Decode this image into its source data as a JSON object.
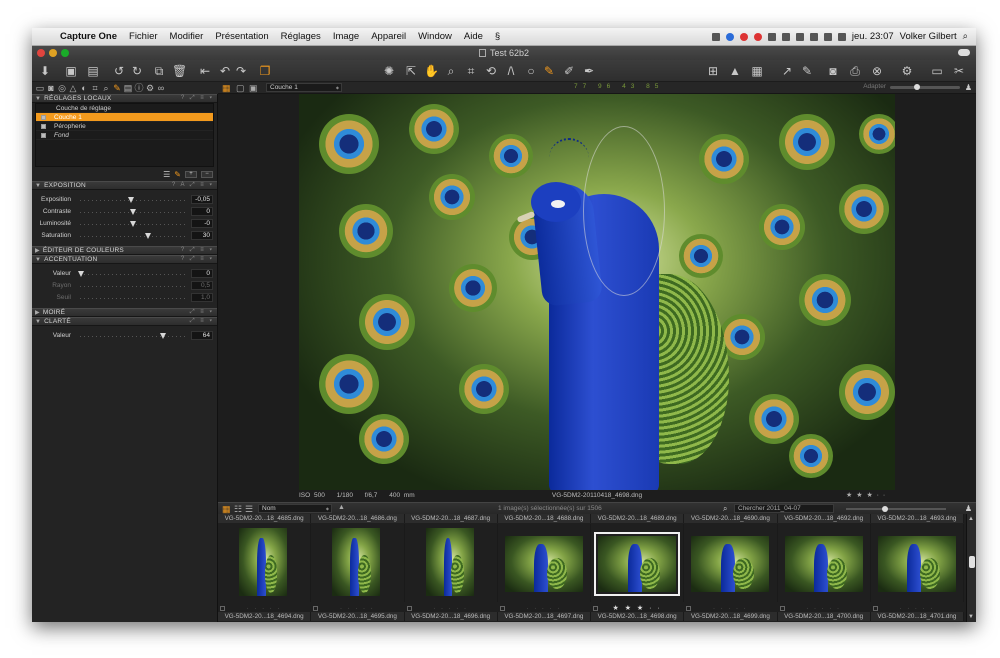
{
  "menubar": {
    "app_name": "Capture One",
    "items": [
      "Fichier",
      "Modifier",
      "Présentation",
      "Réglages",
      "Image",
      "Appareil",
      "Window",
      "Aide"
    ],
    "clock": "jeu. 23:07",
    "user": "Volker Gilbert"
  },
  "window": {
    "title": "Test 62b2"
  },
  "viewer_header": {
    "layer_select": "Couche 1",
    "nums": [
      "77",
      "96",
      "43",
      "85"
    ],
    "fit_label": "Adapter"
  },
  "left_panel": {
    "local_adjustments": {
      "title": "RÉGLAGES LOCAUX",
      "layers": [
        {
          "label": "Couche de réglage",
          "selected": false,
          "italic": false,
          "checkbox": false
        },
        {
          "label": "Couche 1",
          "selected": true,
          "italic": false,
          "checkbox": true
        },
        {
          "label": "Péropherie",
          "selected": false,
          "italic": false,
          "checkbox": true
        },
        {
          "label": "Fond",
          "selected": false,
          "italic": true,
          "checkbox": true
        }
      ]
    },
    "exposure": {
      "title": "EXPOSITION",
      "sliders": [
        {
          "label": "Exposition",
          "value": "-0,05",
          "pos": 0.48
        },
        {
          "label": "Contraste",
          "value": "0",
          "pos": 0.5
        },
        {
          "label": "Luminosité",
          "value": "-0",
          "pos": 0.5
        },
        {
          "label": "Saturation",
          "value": "30",
          "pos": 0.65
        }
      ]
    },
    "color_editor": {
      "title": "ÉDITEUR DE COULEURS"
    },
    "sharpening": {
      "title": "ACCENTUATION",
      "sliders": [
        {
          "label": "Valeur",
          "value": "0",
          "pos": 0.0,
          "dim": false
        },
        {
          "label": "Rayon",
          "value": "0,5",
          "pos": 0.0,
          "dim": true
        },
        {
          "label": "Seuil",
          "value": "1,0",
          "pos": 0.0,
          "dim": true
        }
      ]
    },
    "moire": {
      "title": "MOIRÉ"
    },
    "clarity": {
      "title": "CLARTÉ",
      "sliders": [
        {
          "label": "Valeur",
          "value": "64",
          "pos": 0.78
        }
      ]
    }
  },
  "viewer_footer": {
    "iso": "ISO 500",
    "shutter": "1/180",
    "aperture": "f/6,7",
    "focal": "400 mm",
    "filename": "VG-5DM2-20110418_4698.dng",
    "stars": "★ ★ ★ · ·"
  },
  "browser_header": {
    "sort": "Nom",
    "count": "1 image(s) sélectionnée(s) sur 1506",
    "search": "Chercher 2011_04-07"
  },
  "browser": {
    "top_filenames": [
      "VG-5DM2-20...18_4685.dng",
      "VG-5DM2-20...18_4686.dng",
      "VG-5DM2-20...18_4687.dng",
      "VG-5DM2-20...18_4688.dng",
      "VG-5DM2-20...18_4689.dng",
      "VG-5DM2-20...18_4690.dng",
      "VG-5DM2-20...18_4692.dng",
      "VG-5DM2-20...18_4693.dng"
    ],
    "thumbnails": [
      {
        "orientation": "portrait",
        "selected": false,
        "stars": "· · · · ·"
      },
      {
        "orientation": "portrait",
        "selected": false,
        "stars": "· · · · ·"
      },
      {
        "orientation": "portrait",
        "selected": false,
        "stars": "· · · · ·"
      },
      {
        "orientation": "landscape",
        "selected": false,
        "stars": "· · · · ·"
      },
      {
        "orientation": "landscape",
        "selected": true,
        "stars": "★ ★ ★ · ·"
      },
      {
        "orientation": "landscape",
        "selected": false,
        "stars": "· · · · ·"
      },
      {
        "orientation": "landscape",
        "selected": false,
        "stars": "· · · · ·"
      },
      {
        "orientation": "landscape",
        "selected": false,
        "stars": "· · · · ·"
      }
    ],
    "bottom_filenames": [
      "VG-5DM2-20...18_4694.dng",
      "VG-5DM2-20...18_4695.dng",
      "VG-5DM2-20...18_4696.dng",
      "VG-5DM2-20...18_4697.dng",
      "VG-5DM2-20...18_4698.dng",
      "VG-5DM2-20...18_4699.dng",
      "VG-5DM2-20...18_4700.dng",
      "VG-5DM2-20...18_4701.dng"
    ]
  },
  "colors": {
    "accent": "#f39a1d",
    "panel": "#232323",
    "viewer": "#1d1d1d"
  }
}
